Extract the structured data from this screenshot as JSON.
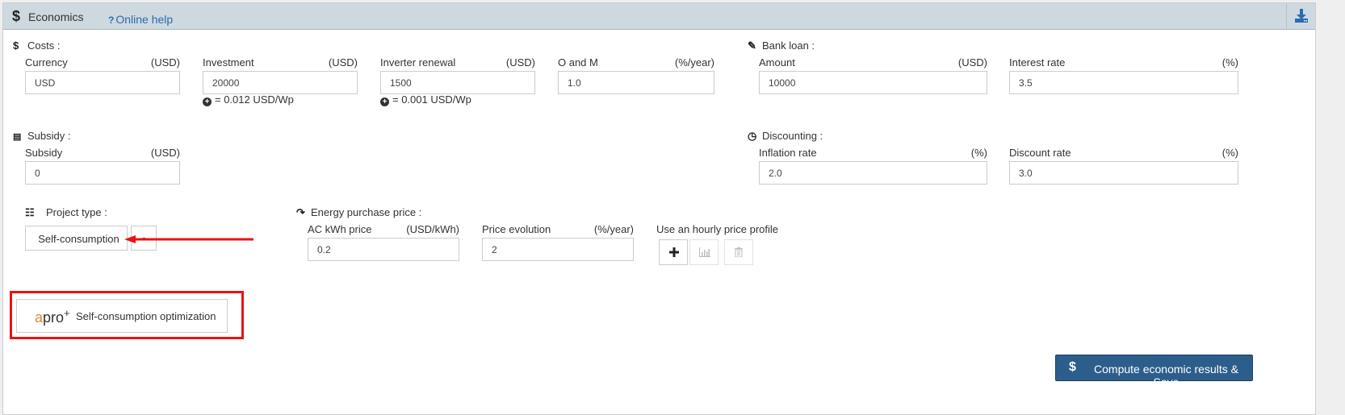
{
  "header": {
    "title": "Economics",
    "help_label": "Online help",
    "help_icon": "?"
  },
  "costs": {
    "title": "Costs :",
    "currency": {
      "label": "Currency",
      "unit": "(USD)",
      "value": "USD"
    },
    "investment": {
      "label": "Investment",
      "unit": "(USD)",
      "value": "20000",
      "hint": "= 0.012 USD/Wp"
    },
    "inverter": {
      "label": "Inverter renewal",
      "unit": "(USD)",
      "value": "1500",
      "hint": "= 0.001 USD/Wp"
    },
    "om": {
      "label": "O and M",
      "unit": "(%/year)",
      "value": "1.0"
    }
  },
  "bank_loan": {
    "title": "Bank loan :",
    "amount": {
      "label": "Amount",
      "unit": "(USD)",
      "value": "10000"
    },
    "interest": {
      "label": "Interest rate",
      "unit": "(%)",
      "value": "3.5"
    }
  },
  "subsidy": {
    "title": "Subsidy :",
    "field": {
      "label": "Subsidy",
      "unit": "(USD)",
      "value": "0"
    }
  },
  "discounting": {
    "title": "Discounting :",
    "inflation": {
      "label": "Inflation rate",
      "unit": "(%)",
      "value": "2.0"
    },
    "discount": {
      "label": "Discount rate",
      "unit": "(%)",
      "value": "3.0"
    }
  },
  "project_type": {
    "title": "Project type :",
    "selected": "Self-consumption"
  },
  "energy_price": {
    "title": "Energy purchase price :",
    "kwh": {
      "label": "AC kWh price",
      "unit": "(USD/kWh)",
      "value": "0.2"
    },
    "evolution": {
      "label": "Price evolution",
      "unit": "(%/year)",
      "value": "2"
    },
    "hourly_label": "Use an hourly price profile"
  },
  "optimization": {
    "logo_a": "a",
    "logo_rest": "pro",
    "logo_sup": "+",
    "label": "Self-consumption optimization"
  },
  "compute": {
    "icon": "$",
    "label": "Compute economic results & Save"
  },
  "colors": {
    "header_bg": "#ced9df",
    "link": "#2a6bb0",
    "primary_button": "#2c5e8c",
    "annotation_red": "#ee1111",
    "apro_orange": "#e08a2e"
  }
}
